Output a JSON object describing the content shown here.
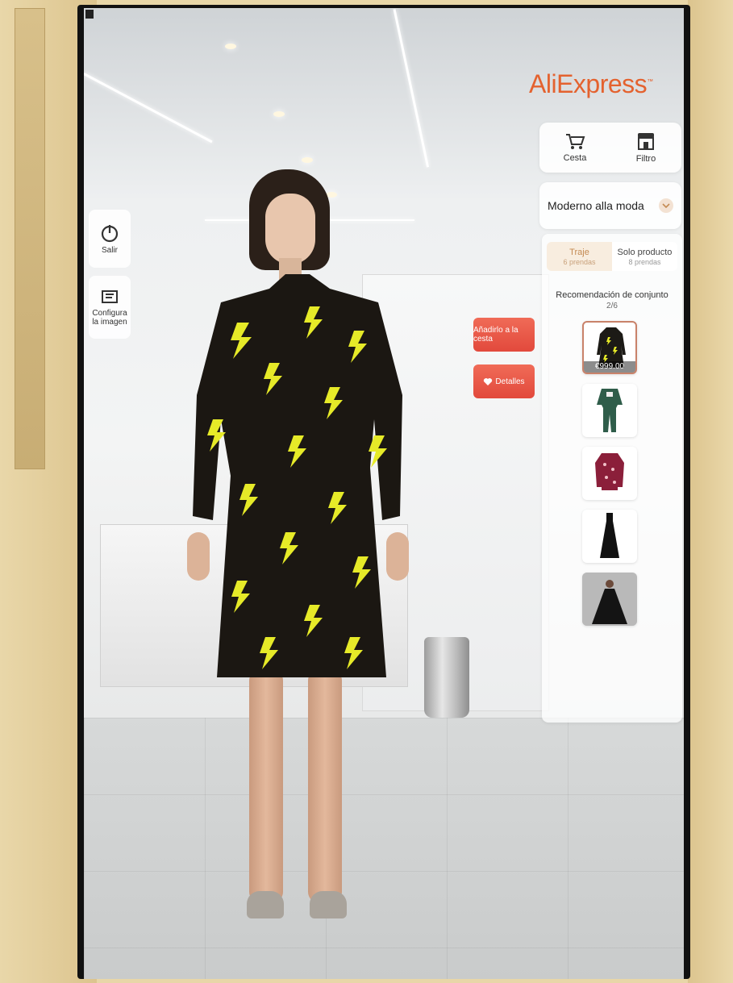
{
  "brand": {
    "logo_text": "AliExpress",
    "accent_color": "#e4622f"
  },
  "top_actions": [
    {
      "label": "Cesta",
      "icon": "shopping-cart-icon"
    },
    {
      "label": "Filtro",
      "icon": "store-icon"
    }
  ],
  "style_select": {
    "value": "Moderno alla moda"
  },
  "side_buttons": [
    {
      "label": "Salir",
      "icon": "power-icon"
    },
    {
      "label": "Configura la imagen",
      "icon": "configure-image-icon"
    }
  ],
  "actions": {
    "add_to_cart": "Añadirlo a la cesta",
    "details": "Detalles"
  },
  "tabs": [
    {
      "label": "Traje",
      "sub": "6 prendas",
      "active": true
    },
    {
      "label": "Solo producto",
      "sub": "8 prendas",
      "active": false
    }
  ],
  "recommendation": {
    "title": "Recomendación de conjunto",
    "count": "2/6",
    "items": [
      {
        "name": "lightning-print-dress",
        "price": "€999.00",
        "selected": true
      },
      {
        "name": "green-tracksuit",
        "selected": false
      },
      {
        "name": "red-print-jacket",
        "selected": false
      },
      {
        "name": "black-slip-dress",
        "selected": false
      },
      {
        "name": "black-cape-outfit",
        "selected": false
      }
    ]
  }
}
